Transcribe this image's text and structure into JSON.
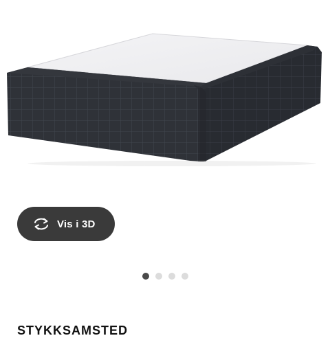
{
  "product_image": {
    "description_icon": "bed-base-image",
    "colors": {
      "top": "#f2f2f4",
      "front": "#2f3238",
      "side": "#262a30",
      "grid": "#3e434b"
    }
  },
  "view_3d_button": {
    "label": "Vis i 3D",
    "icon": "rotate-3d-icon",
    "background": "#3a3a3a"
  },
  "carousel": {
    "total_slides": 4,
    "active_index": 0
  },
  "product_title_partial": "STYKKSAMSTED"
}
